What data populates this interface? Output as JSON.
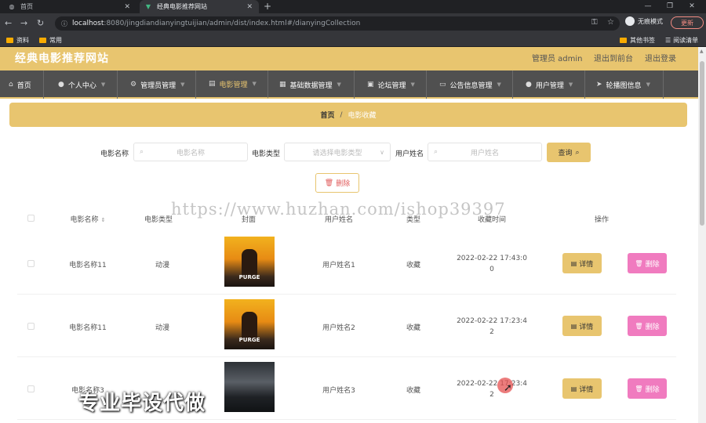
{
  "browser": {
    "tabs": [
      {
        "label": "首页",
        "icon": "globe-icon"
      },
      {
        "label": "经典电影推荐网站",
        "icon": "vue-logo-icon"
      }
    ],
    "url_host": "localhost",
    "url_path": ":8080/jingdiandianyingtuijian/admin/dist/index.html#/dianyingCollection",
    "profile_label": "无痕模式",
    "update_label": "更新",
    "bookmarks": [
      "资料",
      "常用"
    ],
    "bookmarks_right": [
      "其他书签",
      "阅读清单"
    ]
  },
  "header": {
    "site_title": "经典电影推荐网站",
    "admin_label": "管理员 admin",
    "back_front": "退出到前台",
    "logout": "退出登录"
  },
  "menu": {
    "items": [
      {
        "label": "首页",
        "icon": "home-icon"
      },
      {
        "label": "个人中心",
        "icon": "user-icon"
      },
      {
        "label": "管理员管理",
        "icon": "gear-icon"
      },
      {
        "label": "电影管理",
        "icon": "film-icon"
      },
      {
        "label": "基础数据管理",
        "icon": "database-icon"
      },
      {
        "label": "论坛管理",
        "icon": "forum-icon"
      },
      {
        "label": "公告信息管理",
        "icon": "notice-icon"
      },
      {
        "label": "用户管理",
        "icon": "users-icon"
      },
      {
        "label": "轮播图信息",
        "icon": "image-icon"
      }
    ],
    "active_index": 3
  },
  "breadcrumb": {
    "home": "首页",
    "separator": "/",
    "current": "电影收藏"
  },
  "search": {
    "name_label": "电影名称",
    "name_placeholder": "电影名称",
    "type_label": "电影类型",
    "type_placeholder": "请选择电影类型",
    "user_label": "用户姓名",
    "user_placeholder": "用户姓名",
    "search_button": "查询",
    "delete_button": "删除"
  },
  "table": {
    "columns": [
      "电影名称",
      "电影类型",
      "封面",
      "用户姓名",
      "类型",
      "收藏时间",
      "操作"
    ],
    "rows": [
      {
        "name": "电影名称11",
        "type": "动漫",
        "poster_text": "PURGE",
        "user": "用户姓名1",
        "kind": "收藏",
        "time": "2022-02-22 17:43:0",
        "time2": "0"
      },
      {
        "name": "电影名称11",
        "type": "动漫",
        "poster_text": "PURGE",
        "user": "用户姓名2",
        "kind": "收藏",
        "time": "2022-02-22 17:23:4",
        "time2": "2"
      },
      {
        "name": "电影名称3",
        "type": "",
        "poster_text": "",
        "user": "用户姓名3",
        "kind": "收藏",
        "time": "2022-02-22 17:23:4",
        "time2": "2"
      }
    ],
    "detail_label": "详情",
    "delete_label": "删除"
  },
  "overlay": {
    "watermark": "https://www.huzhan.com/ishop39397",
    "promo": "专业毕设代做"
  }
}
